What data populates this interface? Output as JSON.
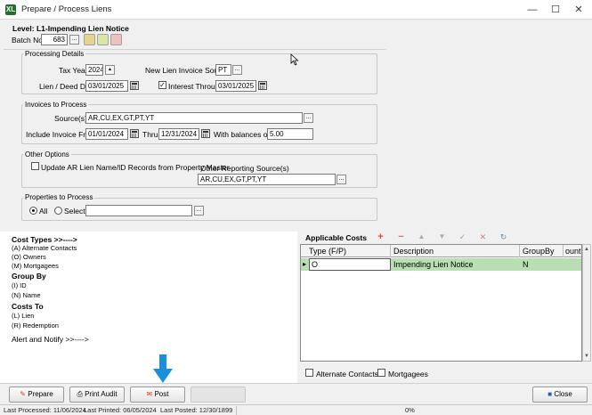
{
  "window": {
    "title": "Prepare / Process Liens",
    "app_icon": "XL",
    "minimize": "—",
    "maximize": "☐",
    "close": "✕"
  },
  "header": {
    "level_label": "Level:",
    "level_value": "L1-Impending Lien Notice",
    "batch_label": "Batch No:",
    "batch_value": "683",
    "lookup": "..."
  },
  "processing": {
    "group_label": "Processing Details",
    "tax_year_label": "Tax Year",
    "tax_year_value": "2024",
    "invoice_source_label": "New Lien Invoice Source",
    "invoice_source_value": "PT",
    "lien_date_label": "Lien / Deed Date",
    "lien_date_value": "03/01/2025",
    "interest_label": "Interest Through",
    "interest_checked": "✓",
    "interest_value": "03/01/2025"
  },
  "invoices": {
    "group_label": "Invoices to Process",
    "sources_label": "Source(s)",
    "sources_value": "AR,CU,EX,GT,PT,YT",
    "from_label": "Include Invoice From",
    "from_value": "01/01/2024",
    "thru_label": "Thru",
    "thru_value": "12/31/2024",
    "balance_label": "With balances over",
    "balance_value": "5.00"
  },
  "other": {
    "group_label": "Other Options",
    "update_label": "Update AR Lien Name/ID Records from Property Master",
    "reporting_label": "Other Reporting Source(s)",
    "reporting_value": "AR,CU,EX,GT,PT,YT"
  },
  "properties": {
    "group_label": "Properties to Process",
    "all_label": "All",
    "select_label": "Select",
    "select_value": ""
  },
  "legend": {
    "cost_types_header": "Cost Types >>---->",
    "cost_types": [
      "(A) Alternate Contacts",
      "(O) Owners",
      "(M) Mortgagees"
    ],
    "group_by_header": "Group By",
    "group_by": [
      "(I) ID",
      "(N) Name"
    ],
    "costs_to_header": "Costs To",
    "costs_to": [
      "(L) Lien",
      "(R) Redemption"
    ],
    "alert_text": "Alert and Notify >>---->"
  },
  "applicable_costs": {
    "title": "Applicable Costs",
    "toolbar": {
      "add": "+",
      "remove": "−",
      "up": "▲",
      "confirm": "✓",
      "cancel": "✕",
      "refresh": "↻"
    },
    "columns": [
      "Type (F/P)",
      "Description",
      "GroupBy",
      "ount"
    ],
    "rows": [
      {
        "indicator": "▸",
        "type": "O",
        "description": "Impending Lien Notice",
        "group_by": "N"
      }
    ],
    "scroll_up": "▲",
    "scroll_down": "▼",
    "alt_contacts_label": "Alternate Contacts",
    "mortgagees_label": "Mortgagees"
  },
  "buttons": {
    "prepare": "Prepare",
    "print_audit": "Print Audit",
    "post": "Post",
    "close": "Close"
  },
  "status": {
    "last_processed": "Last Processed: 11/06/2024",
    "last_printed": "Last Printed: 06/05/2024",
    "last_posted": "Last Posted: 12/30/1899",
    "progress": "0%"
  },
  "colors": {
    "selected_row": "#b7dfb1",
    "add_icon": "#e24a2c",
    "annotation_arrow": "#1a8fdc"
  }
}
